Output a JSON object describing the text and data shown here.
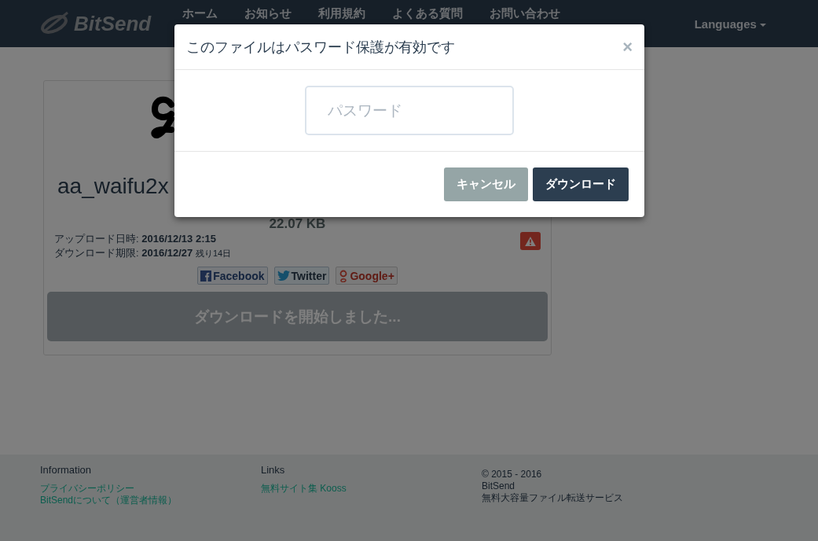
{
  "navbar": {
    "brand": "BitSend",
    "links": [
      "ホーム",
      "お知らせ",
      "利用規約",
      "よくある質問",
      "お問い合わせ"
    ],
    "languages": "Languages"
  },
  "file_card": {
    "filename": "aa_waifu2x",
    "size": "22.07 KB",
    "upload_label": "アップロード日時:",
    "upload_date": "2016/12/13 2:15",
    "expiry_label": "ダウンロード期限:",
    "expiry_date": "2016/12/27",
    "remaining": "残り14日",
    "share": [
      {
        "label": "Facebook",
        "kind": "facebook"
      },
      {
        "label": "Twitter",
        "kind": "twitter"
      },
      {
        "label": "Google+",
        "kind": "google"
      }
    ],
    "status_button": "ダウンロードを開始しました..."
  },
  "modal": {
    "title": "このファイルはパスワード保護が有効です",
    "close": "×",
    "password": {
      "placeholder": "パスワード"
    },
    "buttons": [
      {
        "label": "キャンセル",
        "kind": "secondary"
      },
      {
        "label": "ダウンロード",
        "kind": "primary"
      }
    ]
  },
  "footer": {
    "information": {
      "heading": "Information",
      "links": [
        "プライバシーポリシー",
        "BitSendについて（運営者情報）"
      ]
    },
    "links": {
      "heading": "Links",
      "links": [
        "無料サイト集 Kooss"
      ]
    },
    "about": {
      "lines": [
        "© 2015 - 2016",
        "BitSend",
        "無料大容量ファイル転送サービス"
      ]
    }
  }
}
